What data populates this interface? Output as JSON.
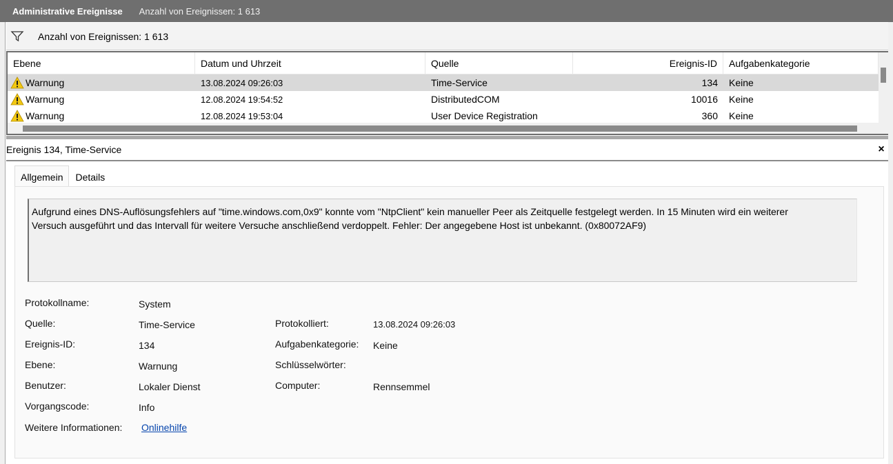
{
  "titlebar": {
    "title": "Administrative Ereignisse",
    "subtitle": "Anzahl von Ereignissen: 1 613"
  },
  "filterbar": {
    "icon": "filter-icon",
    "count_label": "Anzahl von Ereignissen: 1 613"
  },
  "grid": {
    "columns": [
      "Ebene",
      "Datum und Uhrzeit",
      "Quelle",
      "Ereignis-ID",
      "Aufgabenkategorie"
    ],
    "rows": [
      {
        "ebene": "Warnung",
        "datum": "13.08.2024 09:26:03",
        "quelle": "Time-Service",
        "id": "134",
        "kategorie": "Keine",
        "selected": true
      },
      {
        "ebene": "Warnung",
        "datum": "12.08.2024 19:54:52",
        "quelle": "DistributedCOM",
        "id": "10016",
        "kategorie": "Keine",
        "selected": false
      },
      {
        "ebene": "Warnung",
        "datum": "12.08.2024 19:53:04",
        "quelle": "User Device Registration",
        "id": "360",
        "kategorie": "Keine",
        "selected": false
      }
    ],
    "row_icon": "warning-icon",
    "warning_color": "#f2c811"
  },
  "detail": {
    "title": "Ereignis 134, Time-Service",
    "close": "×",
    "tabs": [
      "Allgemein",
      "Details"
    ],
    "active_tab": "Allgemein",
    "description_line1": "Aufgrund eines DNS-Auflösungsfehlers auf \"time.windows.com,0x9\" konnte vom \"NtpClient\" kein manueller Peer als Zeitquelle festgelegt werden. In 15 Minuten wird ein weiterer",
    "description_line2": "Versuch ausgeführt und das Intervall für weitere Versuche anschließend verdoppelt. Fehler: Der angegebene Host ist unbekannt. (0x80072AF9)",
    "properties": {
      "protokollname_label": "Protokollname:",
      "protokollname": "System",
      "quelle_label": "Quelle:",
      "quelle": "Time-Service",
      "protokolliert_label": "Protokolliert:",
      "protokolliert": "13.08.2024 09:26:03",
      "ereignis_id_label": "Ereignis-ID:",
      "ereignis_id": "134",
      "aufgabenkategorie_label": "Aufgabenkategorie:",
      "aufgabenkategorie": "Keine",
      "ebene_label": "Ebene:",
      "ebene": "Warnung",
      "schluesselwoerter_label": "Schlüsselwörter:",
      "schluesselwoerter": "",
      "benutzer_label": "Benutzer:",
      "benutzer": "Lokaler Dienst",
      "computer_label": "Computer:",
      "computer": "Rennsemmel",
      "vorgangscode_label": "Vorgangscode:",
      "vorgangscode": "Info",
      "weitere_label": "Weitere Informationen:",
      "weitere_link": "Onlinehilfe"
    }
  }
}
